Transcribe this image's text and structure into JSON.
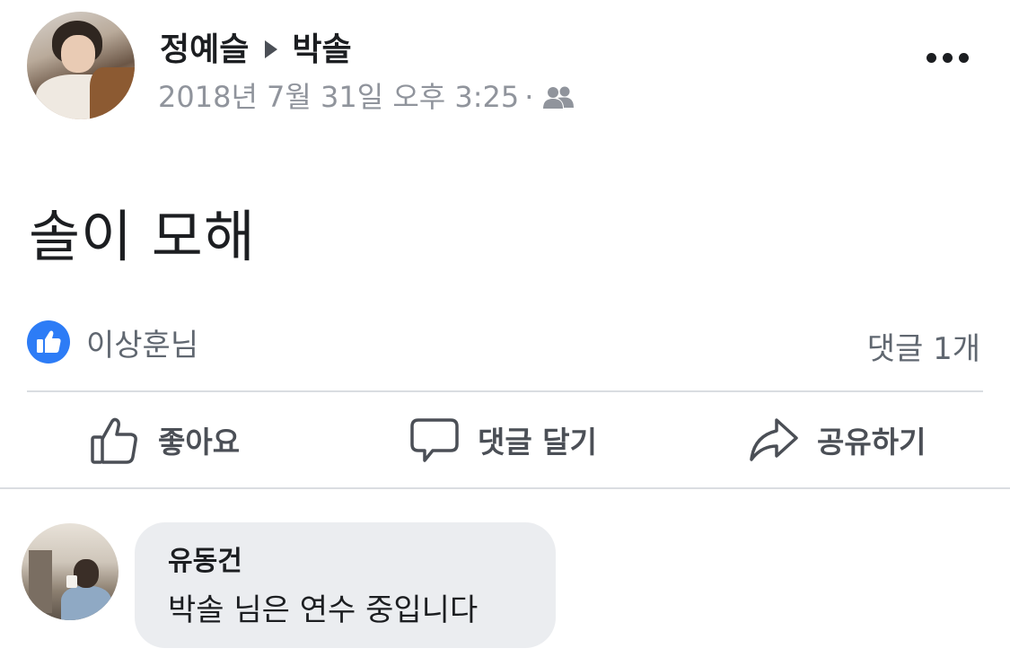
{
  "post": {
    "author": "정예슬",
    "recipient": "박솔",
    "timestamp": "2018년 7월 31일 오후 3:25",
    "separator": "·",
    "audience_icon": "friends-icon",
    "text": "솔이 모해"
  },
  "reactions": {
    "reactors": "이상훈님",
    "comment_count": "댓글 1개",
    "like_color": "#2d7cf6"
  },
  "actions": {
    "like": "좋아요",
    "comment": "댓글 달기",
    "share": "공유하기"
  },
  "comments": [
    {
      "author": "유동건",
      "text": "박솔 님은 연수 중입니다"
    }
  ]
}
